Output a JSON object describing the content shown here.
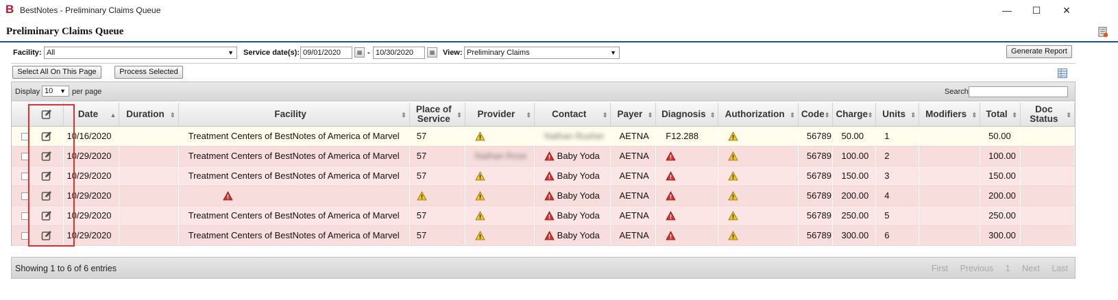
{
  "window": {
    "logo": "B",
    "title": "BestNotes - Preliminary Claims Queue",
    "controls": {
      "minimize": "—",
      "maximize": "☐",
      "close": "✕"
    }
  },
  "page": {
    "title": "Preliminary Claims Queue"
  },
  "filters": {
    "facility_label": "Facility:",
    "facility_value": "All",
    "service_dates_label": "Service date(s):",
    "date_from": "09/01/2020",
    "date_separator": "-",
    "date_to": "10/30/2020",
    "view_label": "View:",
    "view_value": "Preliminary Claims",
    "generate_report": "Generate Report"
  },
  "actions": {
    "select_all": "Select All On This Page",
    "process_selected": "Process Selected"
  },
  "toolbar": {
    "display_label": "Display",
    "display_value": "10",
    "per_page_label": "per page",
    "search_label": "Search:"
  },
  "columns": {
    "date": "Date",
    "duration": "Duration",
    "facility": "Facility",
    "place_of_service_1": "Place of",
    "place_of_service_2": "Service",
    "provider": "Provider",
    "contact": "Contact",
    "payer": "Payer",
    "diagnosis": "Diagnosis",
    "authorization": "Authorization",
    "code": "Code",
    "charge": "Charge",
    "units": "Units",
    "modifiers": "Modifiers",
    "total": "Total",
    "doc_status_1": "Doc",
    "doc_status_2": "Status"
  },
  "rows": [
    {
      "date": "10/16/2020",
      "facility": "Treatment Centers of BestNotes of America of Marvel",
      "pos": "57",
      "contact": "Nathan Rusher",
      "payer": "AETNA",
      "diagnosis": "F12.288",
      "code": "56789",
      "charge": "50.00",
      "units": "1",
      "total": "50.00"
    },
    {
      "date": "10/29/2020",
      "facility": "Treatment Centers of BestNotes of America of Marvel",
      "pos": "57",
      "provider_blur": "Nathan Rose",
      "contact": "Baby Yoda",
      "payer": "AETNA",
      "code": "56789",
      "charge": "100.00",
      "units": "2",
      "total": "100.00"
    },
    {
      "date": "10/29/2020",
      "facility": "Treatment Centers of BestNotes of America of Marvel",
      "pos": "57",
      "contact": "Baby Yoda",
      "payer": "AETNA",
      "code": "56789",
      "charge": "150.00",
      "units": "3",
      "total": "150.00"
    },
    {
      "date": "10/29/2020",
      "facility": "",
      "pos": "",
      "contact": "Baby Yoda",
      "payer": "AETNA",
      "code": "56789",
      "charge": "200.00",
      "units": "4",
      "total": "200.00"
    },
    {
      "date": "10/29/2020",
      "facility": "Treatment Centers of BestNotes of America of Marvel",
      "pos": "57",
      "contact": "Baby Yoda",
      "payer": "AETNA",
      "code": "56789",
      "charge": "250.00",
      "units": "5",
      "total": "250.00"
    },
    {
      "date": "10/29/2020",
      "facility": "Treatment Centers of BestNotes of America of Marvel",
      "pos": "57",
      "contact": "Baby Yoda",
      "payer": "AETNA",
      "code": "56789",
      "charge": "300.00",
      "units": "6",
      "total": "300.00"
    }
  ],
  "footer": {
    "info": "Showing 1 to 6 of 6 entries",
    "first": "First",
    "previous": "Previous",
    "page": "1",
    "next": "Next",
    "last": "Last"
  },
  "colors": {
    "brand_red": "#c8102e",
    "title_rule": "#1f4e8c",
    "row_highlight": "#fffdeb",
    "row_error": "#f7dedd",
    "highlight_box": "#e0302f",
    "warning_yellow": "#f5c518",
    "error_red": "#d9302b"
  },
  "icons": {
    "edit": "edit-icon",
    "warning": "warning-icon",
    "error": "error-icon",
    "calendar": "calendar-icon",
    "report": "report-icon",
    "column_chooser": "column-chooser-icon"
  }
}
